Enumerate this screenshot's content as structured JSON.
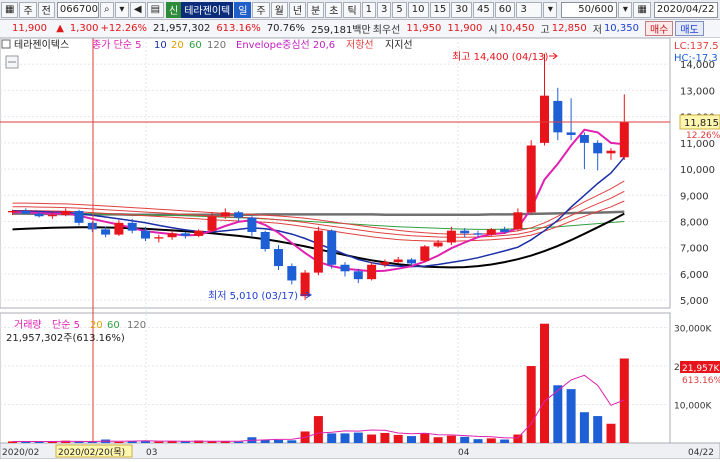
{
  "toolbar": {
    "market_mode": "주",
    "prev_btn": "전",
    "stock_code": "066700",
    "credit_tag": "신",
    "stock_name": "테라젠이텍",
    "periods": [
      "일",
      "주",
      "월",
      "년",
      "분",
      "초",
      "틱"
    ],
    "intervals": [
      "1",
      "3",
      "5",
      "10",
      "15",
      "30",
      "45",
      "60"
    ],
    "interval_select": "3",
    "counter": "50/600",
    "date": "2020/04/22"
  },
  "quote": {
    "price": "11,900",
    "change": "1,300",
    "change_pct": "+12.26%",
    "volume": "21,957,302",
    "vol_pct": "613.16%",
    "ratio": "70.76%",
    "amount": "259,181백만",
    "best_ask_label": "최우선",
    "best_ask": "11,950",
    "best_bid": "11,900",
    "open_label": "시",
    "open": "10,450",
    "high_label": "고",
    "high": "12,850",
    "low_label": "저",
    "low": "10,350",
    "buy_label": "매수",
    "sell_label": "매도"
  },
  "price_panel": {
    "legend": {
      "name": "테라젠이텍스",
      "ma_label": "종가 단순 5",
      "ma_periods": [
        "10",
        "20",
        "60",
        "120"
      ],
      "envelope": "Envelope중심선 20,6",
      "resist": "저항선",
      "support": "지지선"
    },
    "lc_label": "LC:137.5",
    "hc_label": "HC:-17.3",
    "current_price_tag": "11,815",
    "current_pct_tag": "12.26%",
    "high_annotation": "최고 14,400 (04/13)",
    "low_annotation": "최저 5,010 (03/17)",
    "y_ticks": [
      "14,000",
      "13,000",
      "12,000",
      "11,000",
      "10,000",
      "9,000",
      "8,000",
      "7,000",
      "6,000",
      "5,000"
    ]
  },
  "volume_panel": {
    "legend": {
      "name": "거래량",
      "ma_label": "단순 5",
      "ma_periods": [
        "20",
        "60",
        "120"
      ],
      "value": "21,957,302주(613.16%)"
    },
    "y_ticks": [
      "30,000K",
      "20,000K",
      "10,000K"
    ],
    "current_vol_tag": "21,957K",
    "current_pct_tag": "613.16%"
  },
  "x_axis": {
    "labels": [
      "2020/02",
      "2020/02/20(목)",
      "03",
      "04",
      "04/22"
    ]
  },
  "colors": {
    "up": "#e8141b",
    "down": "#1f5fd6",
    "ma5": "#e020b0",
    "ma10": "#1a2fa8",
    "ma60": "#30a040",
    "ma120": "#707070",
    "envelope": "#e04040",
    "support": "#000000"
  },
  "chart_data": {
    "type": "candlestick",
    "candles": [
      {
        "o": 8350,
        "h": 8450,
        "l": 8250,
        "c": 8400
      },
      {
        "o": 8400,
        "h": 8500,
        "l": 8280,
        "c": 8300
      },
      {
        "o": 8300,
        "h": 8380,
        "l": 8150,
        "c": 8200
      },
      {
        "o": 8200,
        "h": 8350,
        "l": 8100,
        "c": 8250
      },
      {
        "o": 8250,
        "h": 8500,
        "l": 8200,
        "c": 8400
      },
      {
        "o": 8400,
        "h": 8450,
        "l": 7850,
        "c": 7950
      },
      {
        "o": 7950,
        "h": 8000,
        "l": 7600,
        "c": 7700
      },
      {
        "o": 7700,
        "h": 7800,
        "l": 7400,
        "c": 7500
      },
      {
        "o": 7500,
        "h": 8050,
        "l": 7450,
        "c": 7950
      },
      {
        "o": 7950,
        "h": 8100,
        "l": 7550,
        "c": 7650
      },
      {
        "o": 7650,
        "h": 7800,
        "l": 7250,
        "c": 7350
      },
      {
        "o": 7350,
        "h": 7500,
        "l": 7200,
        "c": 7400
      },
      {
        "o": 7400,
        "h": 7650,
        "l": 7300,
        "c": 7550
      },
      {
        "o": 7550,
        "h": 7600,
        "l": 7350,
        "c": 7450
      },
      {
        "o": 7450,
        "h": 7700,
        "l": 7400,
        "c": 7650
      },
      {
        "o": 7650,
        "h": 8350,
        "l": 7600,
        "c": 8200
      },
      {
        "o": 8200,
        "h": 8500,
        "l": 8100,
        "c": 8350
      },
      {
        "o": 8350,
        "h": 8400,
        "l": 8000,
        "c": 8150
      },
      {
        "o": 8150,
        "h": 8200,
        "l": 7450,
        "c": 7600
      },
      {
        "o": 7600,
        "h": 7650,
        "l": 6850,
        "c": 6950
      },
      {
        "o": 6950,
        "h": 7100,
        "l": 6150,
        "c": 6300
      },
      {
        "o": 6300,
        "h": 6400,
        "l": 5600,
        "c": 5750
      },
      {
        "o": 5150,
        "h": 6150,
        "l": 5010,
        "c": 6050
      },
      {
        "o": 6050,
        "h": 7800,
        "l": 5950,
        "c": 7650
      },
      {
        "o": 7650,
        "h": 7700,
        "l": 6200,
        "c": 6350
      },
      {
        "o": 6350,
        "h": 6450,
        "l": 5900,
        "c": 6100
      },
      {
        "o": 6100,
        "h": 6200,
        "l": 5650,
        "c": 5800
      },
      {
        "o": 5800,
        "h": 6450,
        "l": 5750,
        "c": 6350
      },
      {
        "o": 6350,
        "h": 6550,
        "l": 6250,
        "c": 6450
      },
      {
        "o": 6450,
        "h": 6650,
        "l": 6400,
        "c": 6550
      },
      {
        "o": 6550,
        "h": 6600,
        "l": 6300,
        "c": 6400
      },
      {
        "o": 6500,
        "h": 7100,
        "l": 6450,
        "c": 7050
      },
      {
        "o": 7050,
        "h": 7300,
        "l": 7000,
        "c": 7200
      },
      {
        "o": 7200,
        "h": 7800,
        "l": 7100,
        "c": 7650
      },
      {
        "o": 7650,
        "h": 7750,
        "l": 7400,
        "c": 7550
      },
      {
        "o": 7550,
        "h": 7650,
        "l": 7400,
        "c": 7500
      },
      {
        "o": 7500,
        "h": 7750,
        "l": 7450,
        "c": 7700
      },
      {
        "o": 7700,
        "h": 7800,
        "l": 7550,
        "c": 7600
      },
      {
        "o": 7700,
        "h": 8500,
        "l": 7650,
        "c": 8350
      },
      {
        "o": 8350,
        "h": 11100,
        "l": 8300,
        "c": 10900
      },
      {
        "o": 11000,
        "h": 14400,
        "l": 10900,
        "c": 12800
      },
      {
        "o": 12600,
        "h": 13100,
        "l": 11100,
        "c": 11400
      },
      {
        "o": 11400,
        "h": 12700,
        "l": 11100,
        "c": 11300
      },
      {
        "o": 11300,
        "h": 11400,
        "l": 10000,
        "c": 11000
      },
      {
        "o": 11000,
        "h": 11100,
        "l": 9950,
        "c": 10600
      },
      {
        "o": 10600,
        "h": 10800,
        "l": 10350,
        "c": 10700
      },
      {
        "o": 10450,
        "h": 12850,
        "l": 10350,
        "c": 11815
      }
    ],
    "volume_k": [
      400,
      350,
      300,
      450,
      600,
      350,
      300,
      900,
      300,
      450,
      500,
      350,
      500,
      400,
      650,
      500,
      400,
      350,
      1500,
      900,
      800,
      700,
      3000,
      7000,
      2500,
      2500,
      2700,
      2200,
      2600,
      2100,
      1800,
      2600,
      1500,
      1900,
      1600,
      1000,
      1200,
      900,
      2200,
      20000,
      31000,
      15000,
      14000,
      8000,
      7000,
      5000,
      21957
    ],
    "ma5": [
      8350,
      8350,
      8320,
      8300,
      8310,
      8220,
      8100,
      7990,
      7880,
      7750,
      7630,
      7570,
      7520,
      7470,
      7490,
      7640,
      7830,
      7990,
      8050,
      7870,
      7570,
      7180,
      6800,
      6460,
      6300,
      6200,
      6150,
      6100,
      6120,
      6200,
      6300,
      6470,
      6700,
      6980,
      7200,
      7400,
      7520,
      7560,
      7750,
      8500,
      9600,
      10200,
      10900,
      11500,
      11400,
      11000,
      10950
    ],
    "ma10": [
      8400,
      8390,
      8380,
      8360,
      8350,
      8300,
      8240,
      8170,
      8100,
      8030,
      7950,
      7850,
      7760,
      7680,
      7620,
      7600,
      7650,
      7700,
      7760,
      7720,
      7640,
      7520,
      7350,
      7150,
      6950,
      6750,
      6550,
      6430,
      6340,
      6300,
      6280,
      6300,
      6360,
      6440,
      6520,
      6620,
      6750,
      6880,
      7020,
      7300,
      7650,
      8050,
      8550,
      9000,
      9450,
      9850,
      10450
    ],
    "envelope_upper": [
      8700,
      8700,
      8690,
      8680,
      8670,
      8650,
      8620,
      8590,
      8560,
      8530,
      8500,
      8470,
      8440,
      8400,
      8370,
      8340,
      8310,
      8290,
      8270,
      8240,
      8210,
      8170,
      8120,
      8060,
      7990,
      7920,
      7850,
      7780,
      7720,
      7660,
      7610,
      7570,
      7540,
      7520,
      7510,
      7520,
      7540,
      7580,
      7640,
      7760,
      7950,
      8200,
      8470,
      8750,
      9000,
      9250,
      9550
    ],
    "envelope_mid": [
      8560,
      8560,
      8550,
      8540,
      8530,
      8510,
      8480,
      8450,
      8420,
      8390,
      8360,
      8330,
      8300,
      8270,
      8240,
      8210,
      8180,
      8160,
      8140,
      8110,
      8070,
      8020,
      7960,
      7890,
      7820,
      7750,
      7680,
      7610,
      7550,
      7500,
      7460,
      7430,
      7410,
      7400,
      7400,
      7410,
      7430,
      7470,
      7520,
      7620,
      7790,
      8000,
      8230,
      8460,
      8680,
      8890,
      9150
    ],
    "envelope_lower": [
      8420,
      8420,
      8410,
      8400,
      8390,
      8370,
      8340,
      8310,
      8280,
      8250,
      8220,
      8190,
      8160,
      8130,
      8100,
      8070,
      8040,
      8020,
      8000,
      7970,
      7930,
      7870,
      7800,
      7720,
      7640,
      7560,
      7490,
      7420,
      7360,
      7310,
      7280,
      7260,
      7250,
      7250,
      7260,
      7280,
      7300,
      7340,
      7390,
      7480,
      7630,
      7810,
      8010,
      8200,
      8380,
      8560,
      8780
    ],
    "ma60": [
      8350,
      8340,
      8330,
      8320,
      8310,
      8300,
      8290,
      8280,
      8270,
      8260,
      8250,
      8240,
      8230,
      8220,
      8200,
      8180,
      8160,
      8140,
      8120,
      8100,
      8070,
      8040,
      8010,
      7980,
      7950,
      7920,
      7890,
      7860,
      7830,
      7800,
      7780,
      7760,
      7740,
      7720,
      7710,
      7700,
      7700,
      7710,
      7720,
      7740,
      7770,
      7800,
      7840,
      7880,
      7920,
      7960,
      8000
    ],
    "ma120": [
      8300,
      8300,
      8290,
      8290,
      8280,
      8280,
      8270,
      8270,
      8270,
      8260,
      8260,
      8260,
      8260,
      8260,
      8260,
      8260,
      8260,
      8260,
      8260,
      8270,
      8270,
      8270,
      8270,
      8270,
      8270,
      8270,
      8270,
      8270,
      8260,
      8260,
      8260,
      8260,
      8260,
      8260,
      8260,
      8260,
      8270,
      8270,
      8280,
      8290,
      8300,
      8310,
      8320,
      8330,
      8340,
      8350,
      8370
    ],
    "support": [
      7700,
      7720,
      7740,
      7760,
      7770,
      7780,
      7780,
      7770,
      7760,
      7740,
      7720,
      7690,
      7660,
      7630,
      7590,
      7550,
      7500,
      7450,
      7390,
      7320,
      7240,
      7150,
      7050,
      6940,
      6830,
      6720,
      6610,
      6520,
      6440,
      6370,
      6320,
      6280,
      6260,
      6250,
      6260,
      6300,
      6360,
      6450,
      6560,
      6700,
      6870,
      7070,
      7290,
      7530,
      7780,
      8030,
      8300
    ],
    "vol_ma5": [
      400,
      400,
      390,
      380,
      420,
      410,
      400,
      500,
      470,
      500,
      560,
      490,
      500,
      440,
      480,
      480,
      470,
      480,
      700,
      800,
      930,
      960,
      1450,
      2600,
      2780,
      3140,
      3100,
      3380,
      3300,
      2600,
      2380,
      2520,
      2160,
      2100,
      1920,
      1720,
      1640,
      1320,
      1380,
      5020,
      10900,
      13600,
      16400,
      17600,
      15000,
      9800,
      11200
    ],
    "ylim": [
      4700,
      15000
    ],
    "vol_ylim": [
      0,
      33000
    ]
  }
}
